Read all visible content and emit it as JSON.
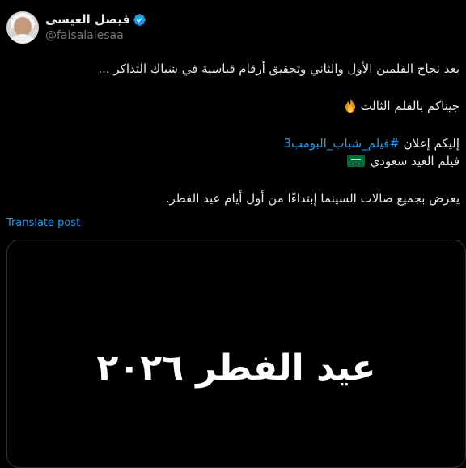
{
  "author": {
    "display_name": "فيصل العيسى",
    "handle": "@faisalalesaa",
    "verified_color": "#1d9bf0"
  },
  "post": {
    "line1": "بعد نجاح الفلمين الأول والثاني وتحقيق أرقام قياسية في شباك التذاكر ...",
    "line2": "جيناكم بالفلم الثالث",
    "line2_emoji": "fire-emoji",
    "line3_prefix": "إليكم إعلان",
    "line3_hashtag": "#فيلم_شباب_البومب3",
    "line4": "فيلم العيد سعودي",
    "line4_emoji": "saudi-flag-emoji",
    "line5": "يعرض بجميع صالات السينما إبتداءًا من أول أيام عيد الفطر."
  },
  "translate_label": "Translate post",
  "media": {
    "title_text": "عيد الفطر ٢٠٢٦"
  }
}
